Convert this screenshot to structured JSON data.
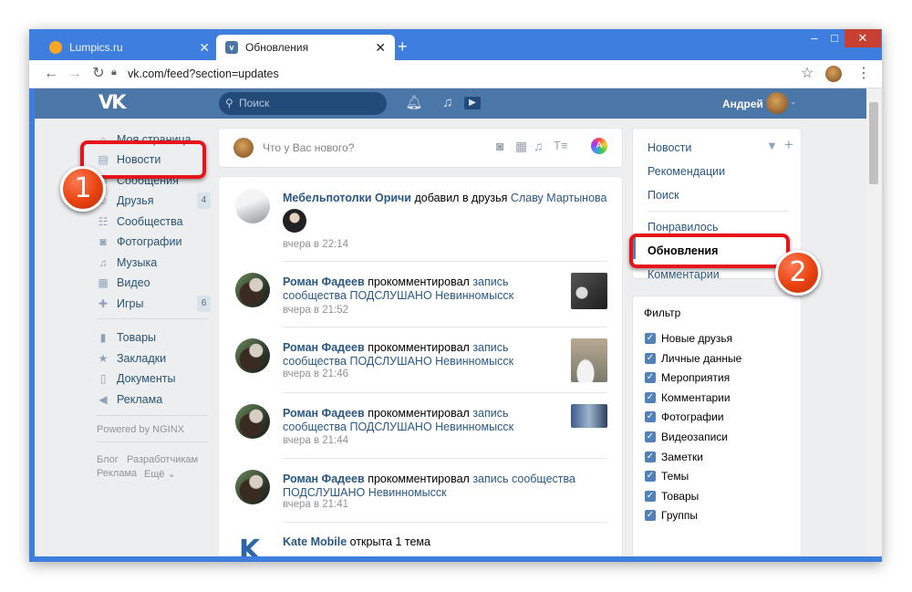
{
  "browser": {
    "tabs": [
      {
        "title": "Lumpics.ru",
        "active": false
      },
      {
        "title": "Обновления",
        "active": true
      }
    ],
    "new_tab": "+",
    "url": "vk.com/feed?section=updates",
    "window_controls": {
      "minimize": "–",
      "maximize": "□",
      "close": "✕"
    },
    "accent_color": "#3d7ede"
  },
  "vk_header": {
    "logo": "VK",
    "search_placeholder": "Поиск",
    "user_name": "Андрей",
    "brand_color": "#4a76a8"
  },
  "left_menu": {
    "items": [
      {
        "label": "Моя страница",
        "icon": "home-icon"
      },
      {
        "label": "Новости",
        "icon": "news-icon"
      },
      {
        "label": "Сообщения",
        "icon": "messages-icon"
      },
      {
        "label": "Друзья",
        "icon": "friends-icon",
        "count": "4"
      },
      {
        "label": "Сообщества",
        "icon": "groups-icon"
      },
      {
        "label": "Фотографии",
        "icon": "camera-icon"
      },
      {
        "label": "Музыка",
        "icon": "music-icon"
      },
      {
        "label": "Видео",
        "icon": "video-icon"
      },
      {
        "label": "Игры",
        "icon": "gamepad-icon",
        "count": "6"
      },
      {
        "label": "Товары",
        "icon": "bag-icon"
      },
      {
        "label": "Закладки",
        "icon": "star-icon"
      },
      {
        "label": "Документы",
        "icon": "document-icon"
      },
      {
        "label": "Реклама",
        "icon": "megaphone-icon"
      }
    ],
    "powered": "Powered by NGINX",
    "footer_links": [
      "Блог",
      "Разработчикам",
      "Реклама",
      "Ещё ⌄"
    ]
  },
  "composer": {
    "placeholder": "Что у Вас нового?"
  },
  "feed": [
    {
      "author": "Мебельпотолки Оричи",
      "action": "добавил в друзья",
      "target": "Славу Мартынова",
      "time": "вчера в 22:14"
    },
    {
      "author": "Роман Фадеев",
      "action": "прокомментировал",
      "target": "запись сообщества",
      "target2": "ПОДСЛУШАНО Невинномысск",
      "time": "вчера в 21:52"
    },
    {
      "author": "Роман Фадеев",
      "action": "прокомментировал",
      "target": "запись сообщества",
      "target2": "ПОДСЛУШАНО Невинномысск",
      "time": "вчера в 21:46"
    },
    {
      "author": "Роман Фадеев",
      "action": "прокомментировал",
      "target": "запись сообщества",
      "target2": "ПОДСЛУШАНО Невинномысск",
      "time": "вчера в 21:44"
    },
    {
      "author": "Роман Фадеев",
      "action": "прокомментировал",
      "target": "запись сообщества ПОДСЛУШАНО",
      "target2": "Невинномысск",
      "time": "вчера в 21:41"
    },
    {
      "author": "Kate Mobile",
      "action": "открыта 1 тема"
    }
  ],
  "right_menu": {
    "items": [
      "Новости",
      "Рекомендации",
      "Поиск",
      "Понравилось",
      "Обновления",
      "Комментарии"
    ],
    "selected": "Обновления"
  },
  "filter": {
    "title": "Фильтр",
    "options": [
      "Новые друзья",
      "Личные данные",
      "Мероприятия",
      "Комментарии",
      "Фотографии",
      "Видеозаписи",
      "Заметки",
      "Темы",
      "Товары",
      "Группы"
    ]
  },
  "annotations": {
    "step1": "1",
    "step2": "2",
    "highlight_color": "#e8121b"
  }
}
